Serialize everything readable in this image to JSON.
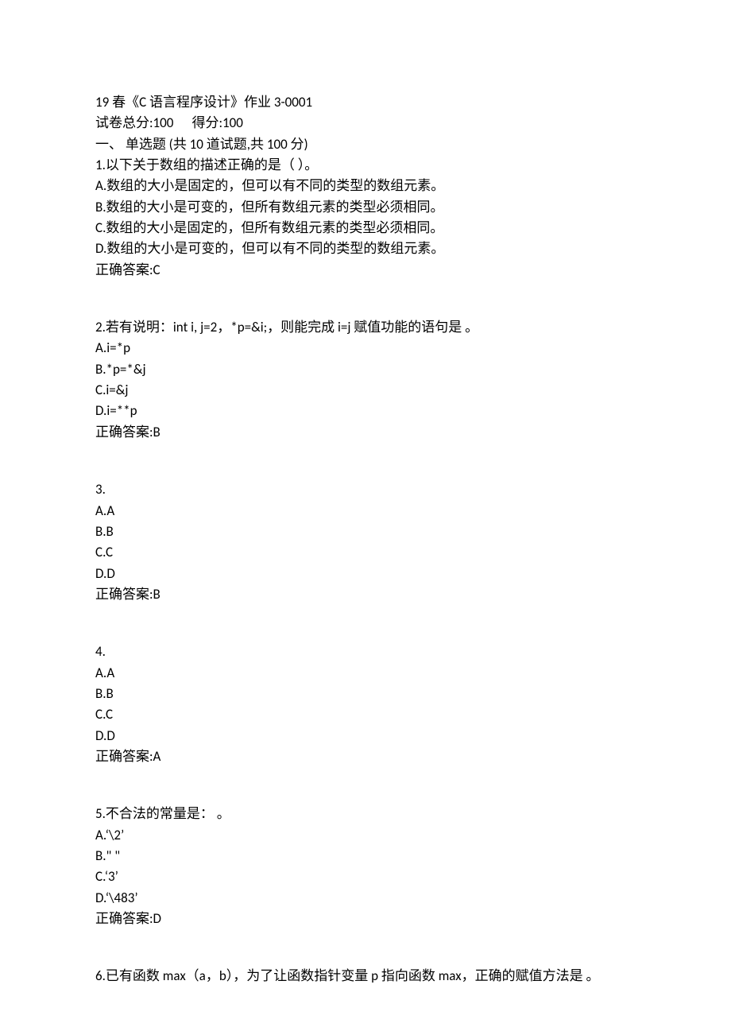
{
  "header": {
    "title": "19 春《C 语言程序设计》作业 3-0001",
    "score_line": "试卷总分:100      得分:100",
    "section_line": "一、 单选题 (共 10 道试题,共 100 分)"
  },
  "questions": [
    {
      "stem": "1.以下关于数组的描述正确的是（ ）。",
      "options": [
        "A.数组的大小是固定的，但可以有不同的类型的数组元素。",
        "B.数组的大小是可变的，但所有数组元素的类型必须相同。",
        "C.数组的大小是固定的，但所有数组元素的类型必须相同。",
        "D.数组的大小是可变的，但可以有不同的类型的数组元素。"
      ],
      "answer": "正确答案:C"
    },
    {
      "stem": "2.若有说明：int i, j=2，*p=&i;，则能完成 i=j 赋值功能的语句是 。",
      "options": [
        "A.i=*p",
        "B.*p=*&j",
        "C.i=&j",
        "D.i=**p"
      ],
      "answer": "正确答案:B"
    },
    {
      "stem": "3.",
      "options": [
        "A.A",
        "B.B",
        "C.C",
        "D.D"
      ],
      "answer": "正确答案:B"
    },
    {
      "stem": "4.",
      "options": [
        "A.A",
        "B.B",
        "C.C",
        "D.D"
      ],
      "answer": "正确答案:A"
    },
    {
      "stem": "5.不合法的常量是： 。",
      "options": [
        "A.‘\\2’",
        "B.\" \"",
        "C.‘3’",
        "D.‘\\483’"
      ],
      "answer": "正确答案:D"
    },
    {
      "stem": "6.已有函数 max（a，b），为了让函数指针变量 p 指向函数 max，正确的赋值方法是 。",
      "options": [],
      "answer": ""
    }
  ]
}
